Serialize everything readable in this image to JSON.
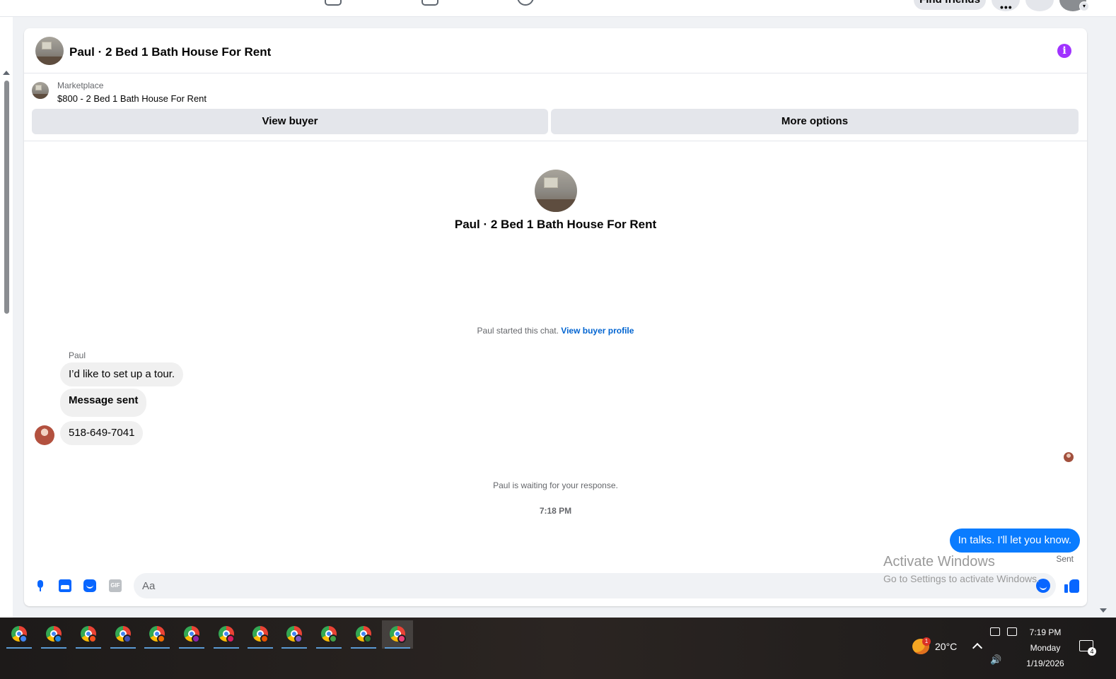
{
  "nav": {
    "find_friends": "Find friends",
    "more_dots": "•••"
  },
  "chat": {
    "header_title": "Paul · 2 Bed 1 Bath House For Rent",
    "info_glyph": "i",
    "marketplace": {
      "label": "Marketplace",
      "item": "$800 - 2 Bed 1 Bath House For Rent"
    },
    "buttons": {
      "view_buyer": "View buyer",
      "more_options": "More options"
    },
    "intro_title": "Paul · 2 Bed 1 Bath House For Rent",
    "started_text": "Paul started this chat.",
    "view_buyer_profile": "View buyer profile",
    "messages": [
      {
        "sender": "Paul",
        "text": "I’d like to set up a tour."
      },
      {
        "sender": "Paul",
        "text": "Message sent"
      },
      {
        "sender": "Paul",
        "text": "518-649-7041"
      }
    ],
    "waiting_text": "Paul is waiting for your response.",
    "timestamp": "7:18 PM",
    "my_message": "In talks. I'll let you know.",
    "sent_status": "Sent",
    "composer": {
      "placeholder": "Aa",
      "gif_label": "GIF"
    }
  },
  "watermark": {
    "line1": "Activate Windows",
    "line2": "Go to Settings to activate Windows."
  },
  "taskbar": {
    "apps": [
      {
        "profile_color": "#4285f4"
      },
      {
        "profile_color": "#1e88e5"
      },
      {
        "profile_color": "#f4511e"
      },
      {
        "profile_color": "#3f51b5"
      },
      {
        "profile_color": "#ef6c00"
      },
      {
        "profile_color": "#8e24aa"
      },
      {
        "profile_color": "#d81b60"
      },
      {
        "profile_color": "#e65100"
      },
      {
        "profile_color": "#7e57c2"
      },
      {
        "profile_color": "#43a047"
      },
      {
        "profile_color": "#2e7d32"
      },
      {
        "profile_color": "#ec407a"
      }
    ],
    "weather_badge": "1",
    "temperature": "20°C",
    "volume_glyph": "🔊",
    "time": "7:19 PM",
    "day": "Monday",
    "date": "1/19/2026",
    "notification_count": "4"
  }
}
